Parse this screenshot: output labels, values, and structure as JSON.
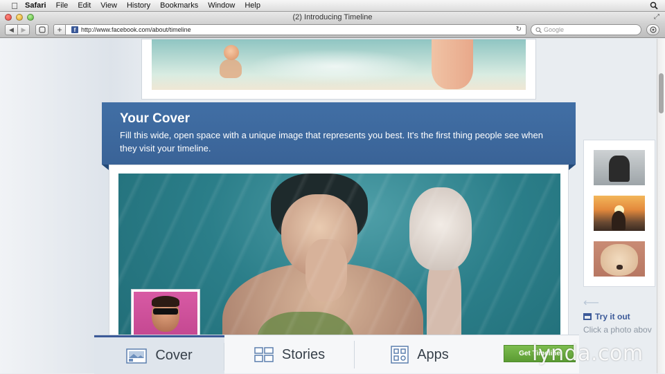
{
  "menubar": {
    "app": "Safari",
    "items": [
      "File",
      "Edit",
      "View",
      "History",
      "Bookmarks",
      "Window",
      "Help"
    ]
  },
  "window": {
    "title": "(2) Introducing Timeline"
  },
  "toolbar": {
    "url": "http://www.facebook.com/about/timeline",
    "search_placeholder": "Google",
    "favicon_letter": "f"
  },
  "banner": {
    "title": "Your Cover",
    "description": "Fill this wide, open space with a unique image that represents you best. It's the first thing people see when they visit your timeline."
  },
  "sidebar": {
    "try_it_label": "Try it out",
    "click_photo_text": "Click a photo abov"
  },
  "bottom_nav": {
    "items": [
      {
        "label": "Cover",
        "icon": "cover-photo-icon",
        "active": true
      },
      {
        "label": "Stories",
        "icon": "stories-grid-icon",
        "active": false
      },
      {
        "label": "Apps",
        "icon": "apps-grid-icon",
        "active": false
      }
    ],
    "cta_label": "Get Timeline"
  },
  "watermark": {
    "text": "lynda.com"
  },
  "colors": {
    "facebook_blue": "#3b5998",
    "banner_blue": "#416fa5",
    "cta_green": "#6aab3f"
  }
}
